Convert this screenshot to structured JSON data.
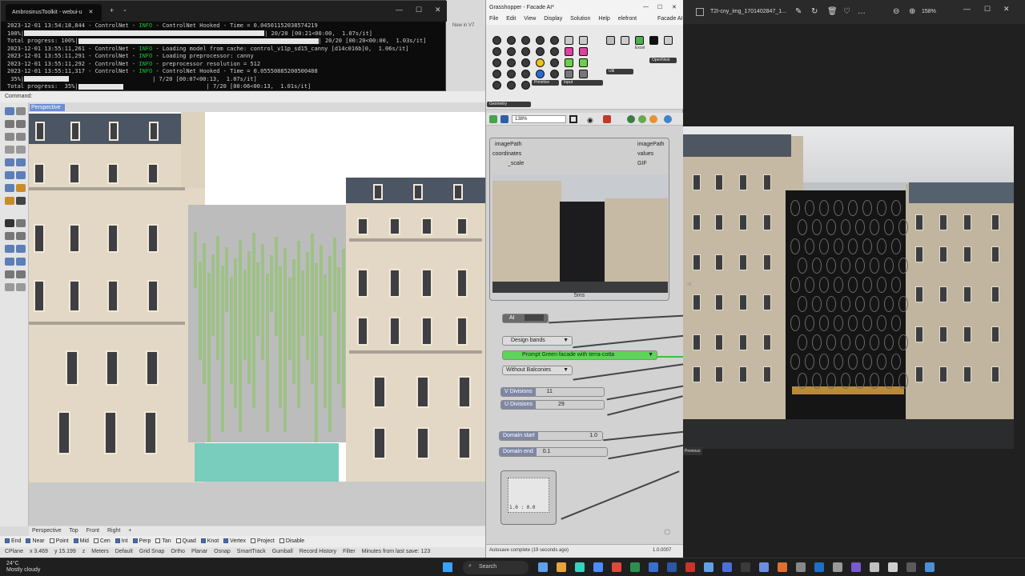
{
  "terminal": {
    "tab_title": "AmbrosinusToolkit - webui-u",
    "lines": [
      {
        "prefix": "2023-12-01 13:54:18,844 - ControlNet - ",
        "level": "INFO",
        "msg": " - ControlNet Hooked - Time = 0.04501152038574219"
      },
      {
        "prefix": "100%|",
        "bar": 1.0,
        "msg": "| 20/20 [00:21<00:00,  1.07s/it]"
      },
      {
        "prefix": "Total progress: 100%|",
        "bar": 1.0,
        "msg": "| 20/20 [00:20<00:00,  1.03s/it]"
      },
      {
        "prefix": "2023-12-01 13:55:11,261 - ControlNet - ",
        "level": "INFO",
        "msg": " - Loading model from cache: control_v11p_sd15_canny [d14c016b]0,  1.06s/it]"
      },
      {
        "prefix": "2023-12-01 13:55:11,291 - ControlNet - ",
        "level": "INFO",
        "msg": " - Loading preprocessor: canny"
      },
      {
        "prefix": "2023-12-01 13:55:11,292 - ControlNet - ",
        "level": "INFO",
        "msg": " - preprocessor resolution = 512"
      },
      {
        "prefix": "2023-12-01 13:55:11,317 - ControlNet - ",
        "level": "INFO",
        "msg": " - ControlNet Hooked - Time = 0.05550885200500488"
      },
      {
        "prefix": " 35%|",
        "bar": 0.35,
        "msg": "| 7/20 [00:07<00:13,  1.07s/it]"
      },
      {
        "prefix": "Total progress:  35%|",
        "bar": 0.35,
        "msg": "| 7/20 [00:06<00:13,  1.01s/it]"
      }
    ]
  },
  "rhino": {
    "command_label": "Command:",
    "viewport_label": "Perspective",
    "view_tabs": [
      "Perspective",
      "Top",
      "Front",
      "Right",
      "+"
    ],
    "osnaps": [
      "End",
      "Near",
      "Point",
      "Mid",
      "Cen",
      "Int",
      "Perp",
      "Tan",
      "Quad",
      "Knot",
      "Vertex",
      "Project",
      "Disable"
    ],
    "status": [
      "CPlane",
      "x 3.469",
      "y 15.199",
      "z",
      "Meters",
      "Default",
      "Grid Snap",
      "Ortho",
      "Planar",
      "Osnap",
      "SmartTrack",
      "Gumball",
      "Record History",
      "Filter",
      "Minutes from last save: 123"
    ],
    "new_in_v7": "New in V7"
  },
  "grasshopper": {
    "title": "Grasshopper - Facade AI*",
    "menu": [
      "File",
      "Edit",
      "View",
      "Display",
      "Solution",
      "Help",
      "elefront"
    ],
    "menu_right": "Facade AI",
    "ribbon_groups": [
      "Geometry",
      "Primitive",
      "Input",
      "Util",
      "OpenNest"
    ],
    "ribbon_label_excel": "Excel",
    "zoom": "138%",
    "component": {
      "inputs": [
        "imagePath",
        "coordinates",
        "_scale"
      ],
      "outputs": [
        "imagePath",
        "values",
        "GIF"
      ],
      "caption": "5ms"
    },
    "toggles": {
      "ai": "AI"
    },
    "dropdowns": {
      "design": "Design bands",
      "prompt": "Prompt Green facade with terra-cotta",
      "balconies": "Without Balconies"
    },
    "sliders": {
      "v_divisions": {
        "label": "V Divisions",
        "value": "11"
      },
      "u_divisions": {
        "label": "U Divisions",
        "value": "29"
      },
      "domain_start": {
        "label": "Domain start",
        "value": "1.0"
      },
      "domain_end": {
        "label": "Domain end",
        "value": "0.1"
      }
    },
    "graph_label": "1.0 : 0.0",
    "status": "Autosave complete (19 seconds ago)",
    "version": "1.0.0007"
  },
  "photos": {
    "title": "T2I-cny_img_1701402847_1...",
    "zoom": "158%",
    "tooltip": "Previous"
  },
  "taskbar": {
    "weather_temp": "24°C",
    "weather_desc": "Mostly cloudy",
    "search": "Search"
  },
  "colors": {
    "info_green": "#1bbf3a",
    "prompt_green": "#5fd35a",
    "slider_label": "#7e88a5",
    "teal_block": "#79cdbd",
    "facade_green": "#9dc186"
  }
}
